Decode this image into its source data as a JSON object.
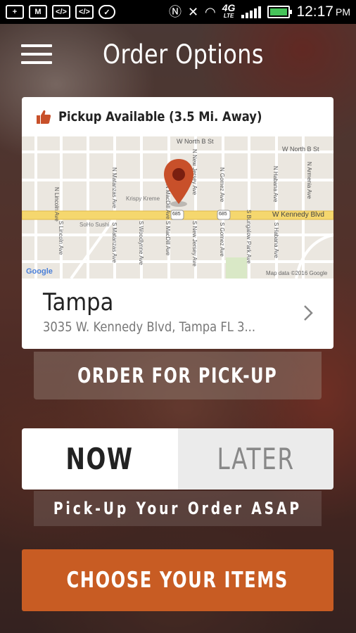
{
  "status_bar": {
    "network": "4G",
    "network_sub": "LTE",
    "time": "12:17",
    "ampm": "PM",
    "battery_fill": 1.0
  },
  "header": {
    "title": "Order Options"
  },
  "location_card": {
    "availability": "Pickup Available (3.5 Mi. Away)",
    "name": "Tampa",
    "address": "3035 W. Kennedy Blvd, Tampa FL 3...",
    "map": {
      "streets": {
        "w_north_b_st_top": "W North B St",
        "w_north_b_st_right": "W North B St",
        "w_kennedy_blvd": "W Kennedy Blvd",
        "n_lincoln_ave": "N Lincoln Ave",
        "n_matanzas_ave": "N Matanzas Ave",
        "n_macdill_ave": "N MacDill Ave",
        "n_new_jersey_ave": "N New Jersey Ave",
        "n_gomez_ave": "N Gomez Ave",
        "n_habana_ave": "N Habana Ave",
        "n_armenia_ave": "N Armenia Ave",
        "s_lincoln_ave": "S Lincoln Ave",
        "s_matanzas_ave": "S Matanzas Ave",
        "s_woodlynne_ave": "S Woodlynne Ave",
        "s_macdill_ave": "S MacDill Ave",
        "s_new_jersey_ave": "S New Jersey Ave",
        "s_gomez_ave": "S Gomez Ave",
        "s_bungalow_park_ave": "S Bungalow Park Ave",
        "s_habana_ave": "S Habana Ave"
      },
      "places": {
        "krispy_kreme": "Krispy Kreme",
        "soho_sushi": "SoHo Sushi"
      },
      "route_shield": "685",
      "google_logo": "Google",
      "map_credit": "Map data ©2016 Google"
    }
  },
  "buttons": {
    "order_pickup": "ORDER FOR PICK-UP",
    "now": "NOW",
    "later": "LATER",
    "choose_items": "CHOOSE YOUR ITEMS"
  },
  "pickup_note": "Pick-Up Your Order ASAP",
  "colors": {
    "accent": "#c85c23",
    "marker": "#c8502a",
    "kennedy_road": "#f5d76e"
  }
}
